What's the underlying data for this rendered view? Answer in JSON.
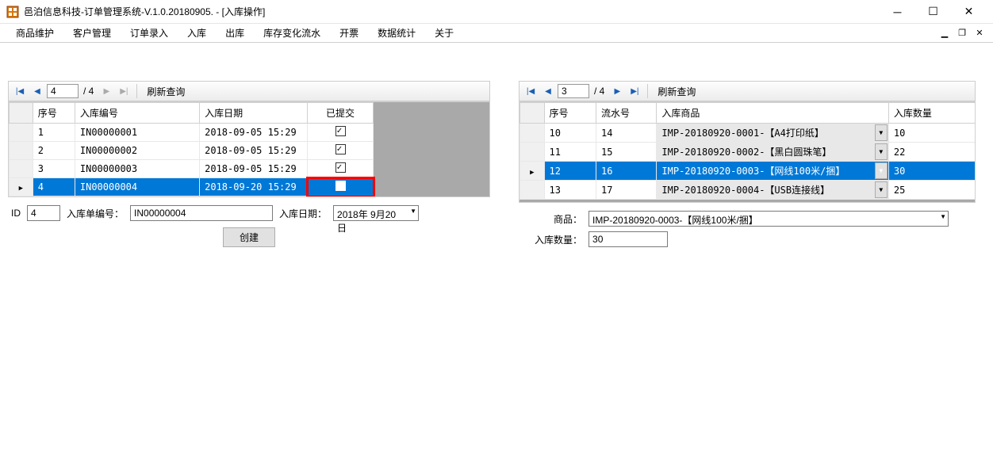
{
  "title": "邑泊信息科技-订单管理系统-V.1.0.20180905. - [入库操作]",
  "menu": [
    "商品维护",
    "客户管理",
    "订单录入",
    "入库",
    "出库",
    "库存变化流水",
    "开票",
    "数据统计",
    "关于"
  ],
  "left": {
    "nav": {
      "current": "4",
      "total": "/ 4",
      "refresh": "刷新查询"
    },
    "headers": [
      "序号",
      "入库编号",
      "入库日期",
      "已提交"
    ],
    "rows": [
      {
        "seq": "1",
        "code": "IN00000001",
        "date": "2018-09-05 15:29",
        "sel": false
      },
      {
        "seq": "2",
        "code": "IN00000002",
        "date": "2018-09-05 15:29",
        "sel": false
      },
      {
        "seq": "3",
        "code": "IN00000003",
        "date": "2018-09-05 15:29",
        "sel": false
      },
      {
        "seq": "4",
        "code": "IN00000004",
        "date": "2018-09-20 15:29",
        "sel": true
      }
    ],
    "form": {
      "id_label": "ID",
      "id": "4",
      "code_label": "入库单编号：",
      "code": "IN00000004",
      "date_label": "入库日期：",
      "date": "2018年 9月20日",
      "create": "创建"
    }
  },
  "right": {
    "nav": {
      "current": "3",
      "total": "/ 4",
      "refresh": "刷新查询"
    },
    "headers": [
      "序号",
      "流水号",
      "入库商品",
      "入库数量"
    ],
    "rows": [
      {
        "seq": "10",
        "flow": "14",
        "prod": "IMP-20180920-0001-【A4打印纸】",
        "qty": "10",
        "sel": false
      },
      {
        "seq": "11",
        "flow": "15",
        "prod": "IMP-20180920-0002-【黑白圆珠笔】",
        "qty": "22",
        "sel": false
      },
      {
        "seq": "12",
        "flow": "16",
        "prod": "IMP-20180920-0003-【网线100米/捆】",
        "qty": "30",
        "sel": true
      },
      {
        "seq": "13",
        "flow": "17",
        "prod": "IMP-20180920-0004-【USB连接线】",
        "qty": "25",
        "sel": false
      }
    ],
    "form": {
      "prod_label": "商品：",
      "prod": "IMP-20180920-0003-【网线100米/捆】",
      "qty_label": "入库数量：",
      "qty": "30"
    }
  }
}
